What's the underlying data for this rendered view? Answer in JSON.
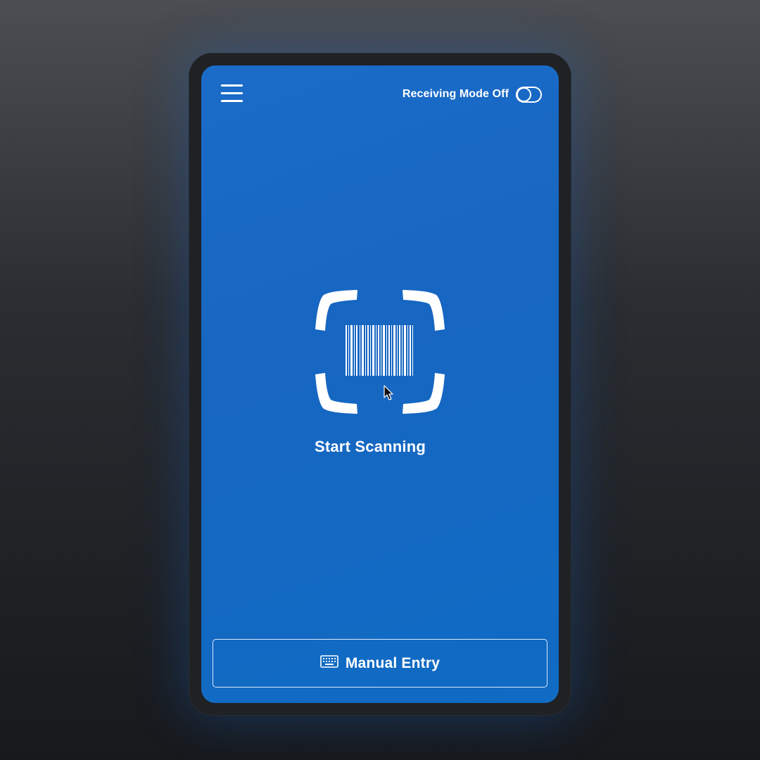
{
  "header": {
    "menu_icon": "hamburger-menu-icon",
    "receiving_mode_label": "Receiving Mode Off",
    "receiving_mode_on": false
  },
  "scanner": {
    "icon": "barcode-scan-icon",
    "label": "Start Scanning"
  },
  "footer": {
    "manual_entry_icon": "keyboard-icon",
    "manual_entry_label": "Manual Entry"
  },
  "colors": {
    "screen_background": "#1766c2",
    "foreground": "#ffffff",
    "device_frame": "#1f2124"
  }
}
